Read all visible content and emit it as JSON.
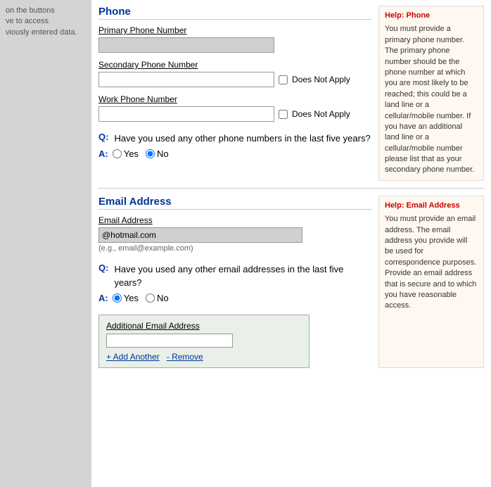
{
  "sidebar": {
    "text1": "on the buttons",
    "text2": "ve to access",
    "text3": "viously entered data."
  },
  "phone_section": {
    "title": "Phone",
    "primary_label": "Primary Phone Number",
    "primary_value": "",
    "secondary_label": "Secondary Phone Number",
    "secondary_value": "",
    "secondary_dna": "Does Not Apply",
    "work_label": "Work Phone Number",
    "work_value": "",
    "work_dna": "Does Not Apply",
    "question": "Have you used any other phone numbers in the last five years?",
    "q_label": "Q:",
    "a_label": "A:",
    "yes_label": "Yes",
    "no_label": "No",
    "answer": "No"
  },
  "phone_help": {
    "title": "Help: Phone",
    "text": "You must provide a primary phone number. The primary phone number should be the phone number at which you are most likely to be reached; this could be a land line or a cellular/mobile number. If you have an additional land line or a cellular/mobile number please list that as your secondary phone number."
  },
  "email_section": {
    "title": "Email Address",
    "email_label": "Email Address",
    "email_value": "@hotmail.com",
    "email_placeholder": "(e.g., email@example.com)",
    "question": "Have you used any other email addresses in the last five years?",
    "q_label": "Q:",
    "a_label": "A:",
    "yes_label": "Yes",
    "no_label": "No",
    "answer": "Yes",
    "additional_title": "Additional Email Address",
    "additional_value": "",
    "add_another": "+ Add Another",
    "remove": "- Remove"
  },
  "email_help": {
    "title": "Help: Email Address",
    "text": "You must provide an email address. The email address you provide will be used for correspondence purposes. Provide an email address that is secure and to which you have reasonable access."
  },
  "you_text": "You"
}
